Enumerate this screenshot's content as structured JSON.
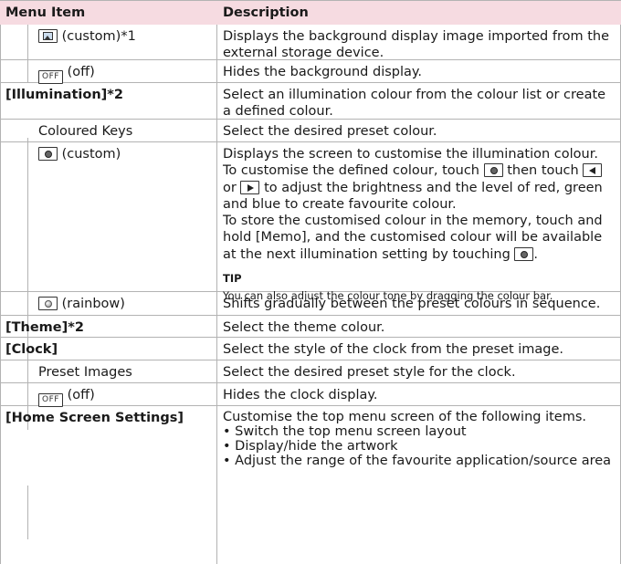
{
  "header": {
    "col1": "Menu Item",
    "col2": "Description"
  },
  "rows": [
    {
      "label": "(custom)*1",
      "desc": "Displays the background display image imported from the external storage device."
    },
    {
      "label": "(off)",
      "button": "OFF",
      "desc": "Hides the background display."
    },
    {
      "label": "[Illumination]*2",
      "desc": "Select an illumination colour from the colour list or create a defined colour."
    },
    {
      "label": "Coloured Keys",
      "desc": "Select the desired preset colour."
    },
    {
      "label": "(custom)",
      "desc_parts": {
        "p1": "Displays the screen to customise the illumination colour.",
        "p2a": "To customise the defined colour, touch",
        "p2b": "then touch",
        "p2c": "or",
        "p2d": "to adjust the brightness and the level of red, green and blue to create favourite colour.",
        "p3a": "To store the customised colour in the memory, touch and hold [Memo], and the customised colour will be available at the next illumination setting by touching",
        "p3b": "."
      },
      "tip_label": "TIP",
      "tip_text": "You can also adjust the colour tone by dragging the colour bar."
    },
    {
      "label": "(rainbow)",
      "desc": "Shifts gradually between the preset colours in sequence."
    },
    {
      "label": "[Theme]*2",
      "desc": "Select the theme colour."
    },
    {
      "label": "[Clock]",
      "desc": "Select the style of the clock from the preset image."
    },
    {
      "label": "Preset Images",
      "desc": "Select the desired preset style for the clock."
    },
    {
      "label": "(off)",
      "button": "OFF",
      "desc": "Hides the clock display."
    },
    {
      "label": "[Home Screen Settings]",
      "desc": "Customise the top menu screen of the following items.",
      "bullets": [
        "• Switch the top menu screen layout",
        "• Display/hide the artwork",
        "• Adjust the range of the favourite application/source area"
      ]
    }
  ],
  "icons": [
    "picture-icon",
    "color-dot-icon",
    "left-arrow-icon",
    "right-arrow-icon",
    "rainbow-icon"
  ],
  "colors": {
    "header_bg": "#f6dbe1",
    "rule": "#b3b3b3"
  }
}
